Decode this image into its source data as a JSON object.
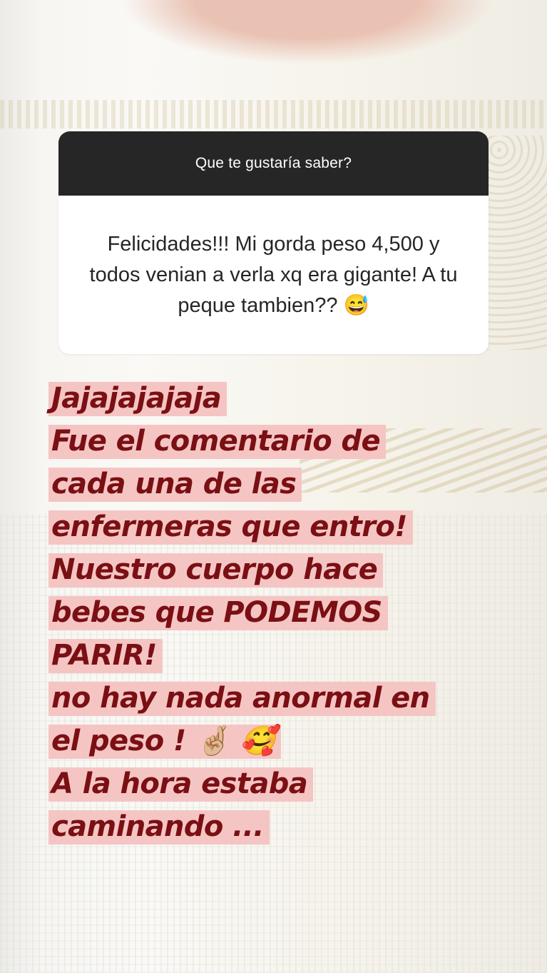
{
  "story": {
    "question_header": "Que te gustaría saber?",
    "question_response": "Felicidades!!! Mi gorda peso 4,500 y todos venian a verla xq era gigante! A tu peque tambien?? 😅",
    "reply_lines": [
      "Jajajajajaja",
      "Fue el comentario de",
      "cada una de las",
      "enfermeras que entro!",
      "Nuestro cuerpo hace",
      "bebes que PODEMOS",
      "PARIR!",
      "no hay nada anormal en",
      "el peso ! 🤞🏼 🥰",
      "A la hora estaba",
      "caminando ..."
    ]
  },
  "colors": {
    "header_bg": "#262626",
    "highlight_bg": "#f5c5c3",
    "reply_text": "#7a0f14"
  }
}
